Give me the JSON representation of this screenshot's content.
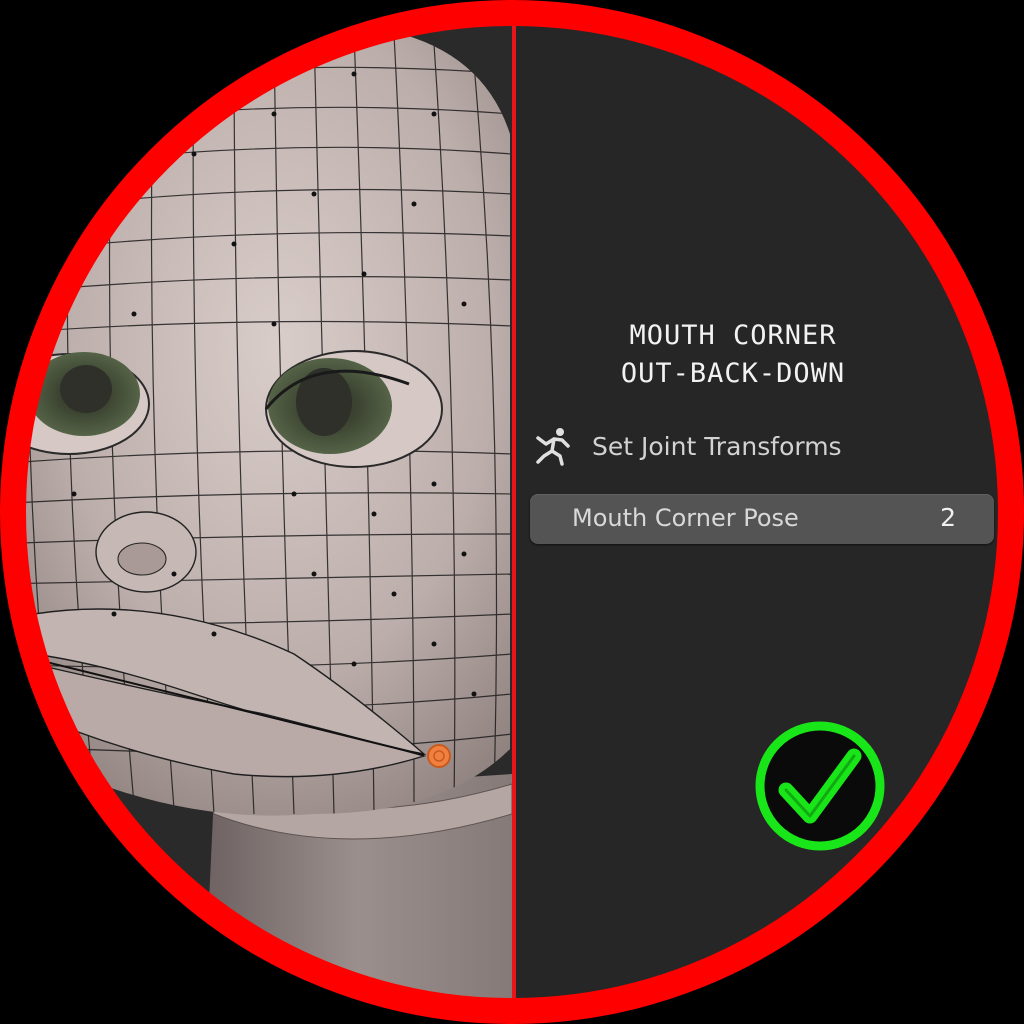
{
  "panel": {
    "title_line1": "MOUTH CORNER",
    "title_line2": "OUT-BACK-DOWN",
    "operator": {
      "label": "Set Joint Transforms",
      "icon": "running-figure-icon"
    },
    "property": {
      "label": "Mouth Corner Pose",
      "value": "2"
    },
    "status_icon": "checkmark-circle-icon"
  },
  "colors": {
    "frame": "#ff0000",
    "divider": "#e8141b",
    "check": "#19e619",
    "control_point": "#f08040",
    "panel_bg": "#262626"
  }
}
